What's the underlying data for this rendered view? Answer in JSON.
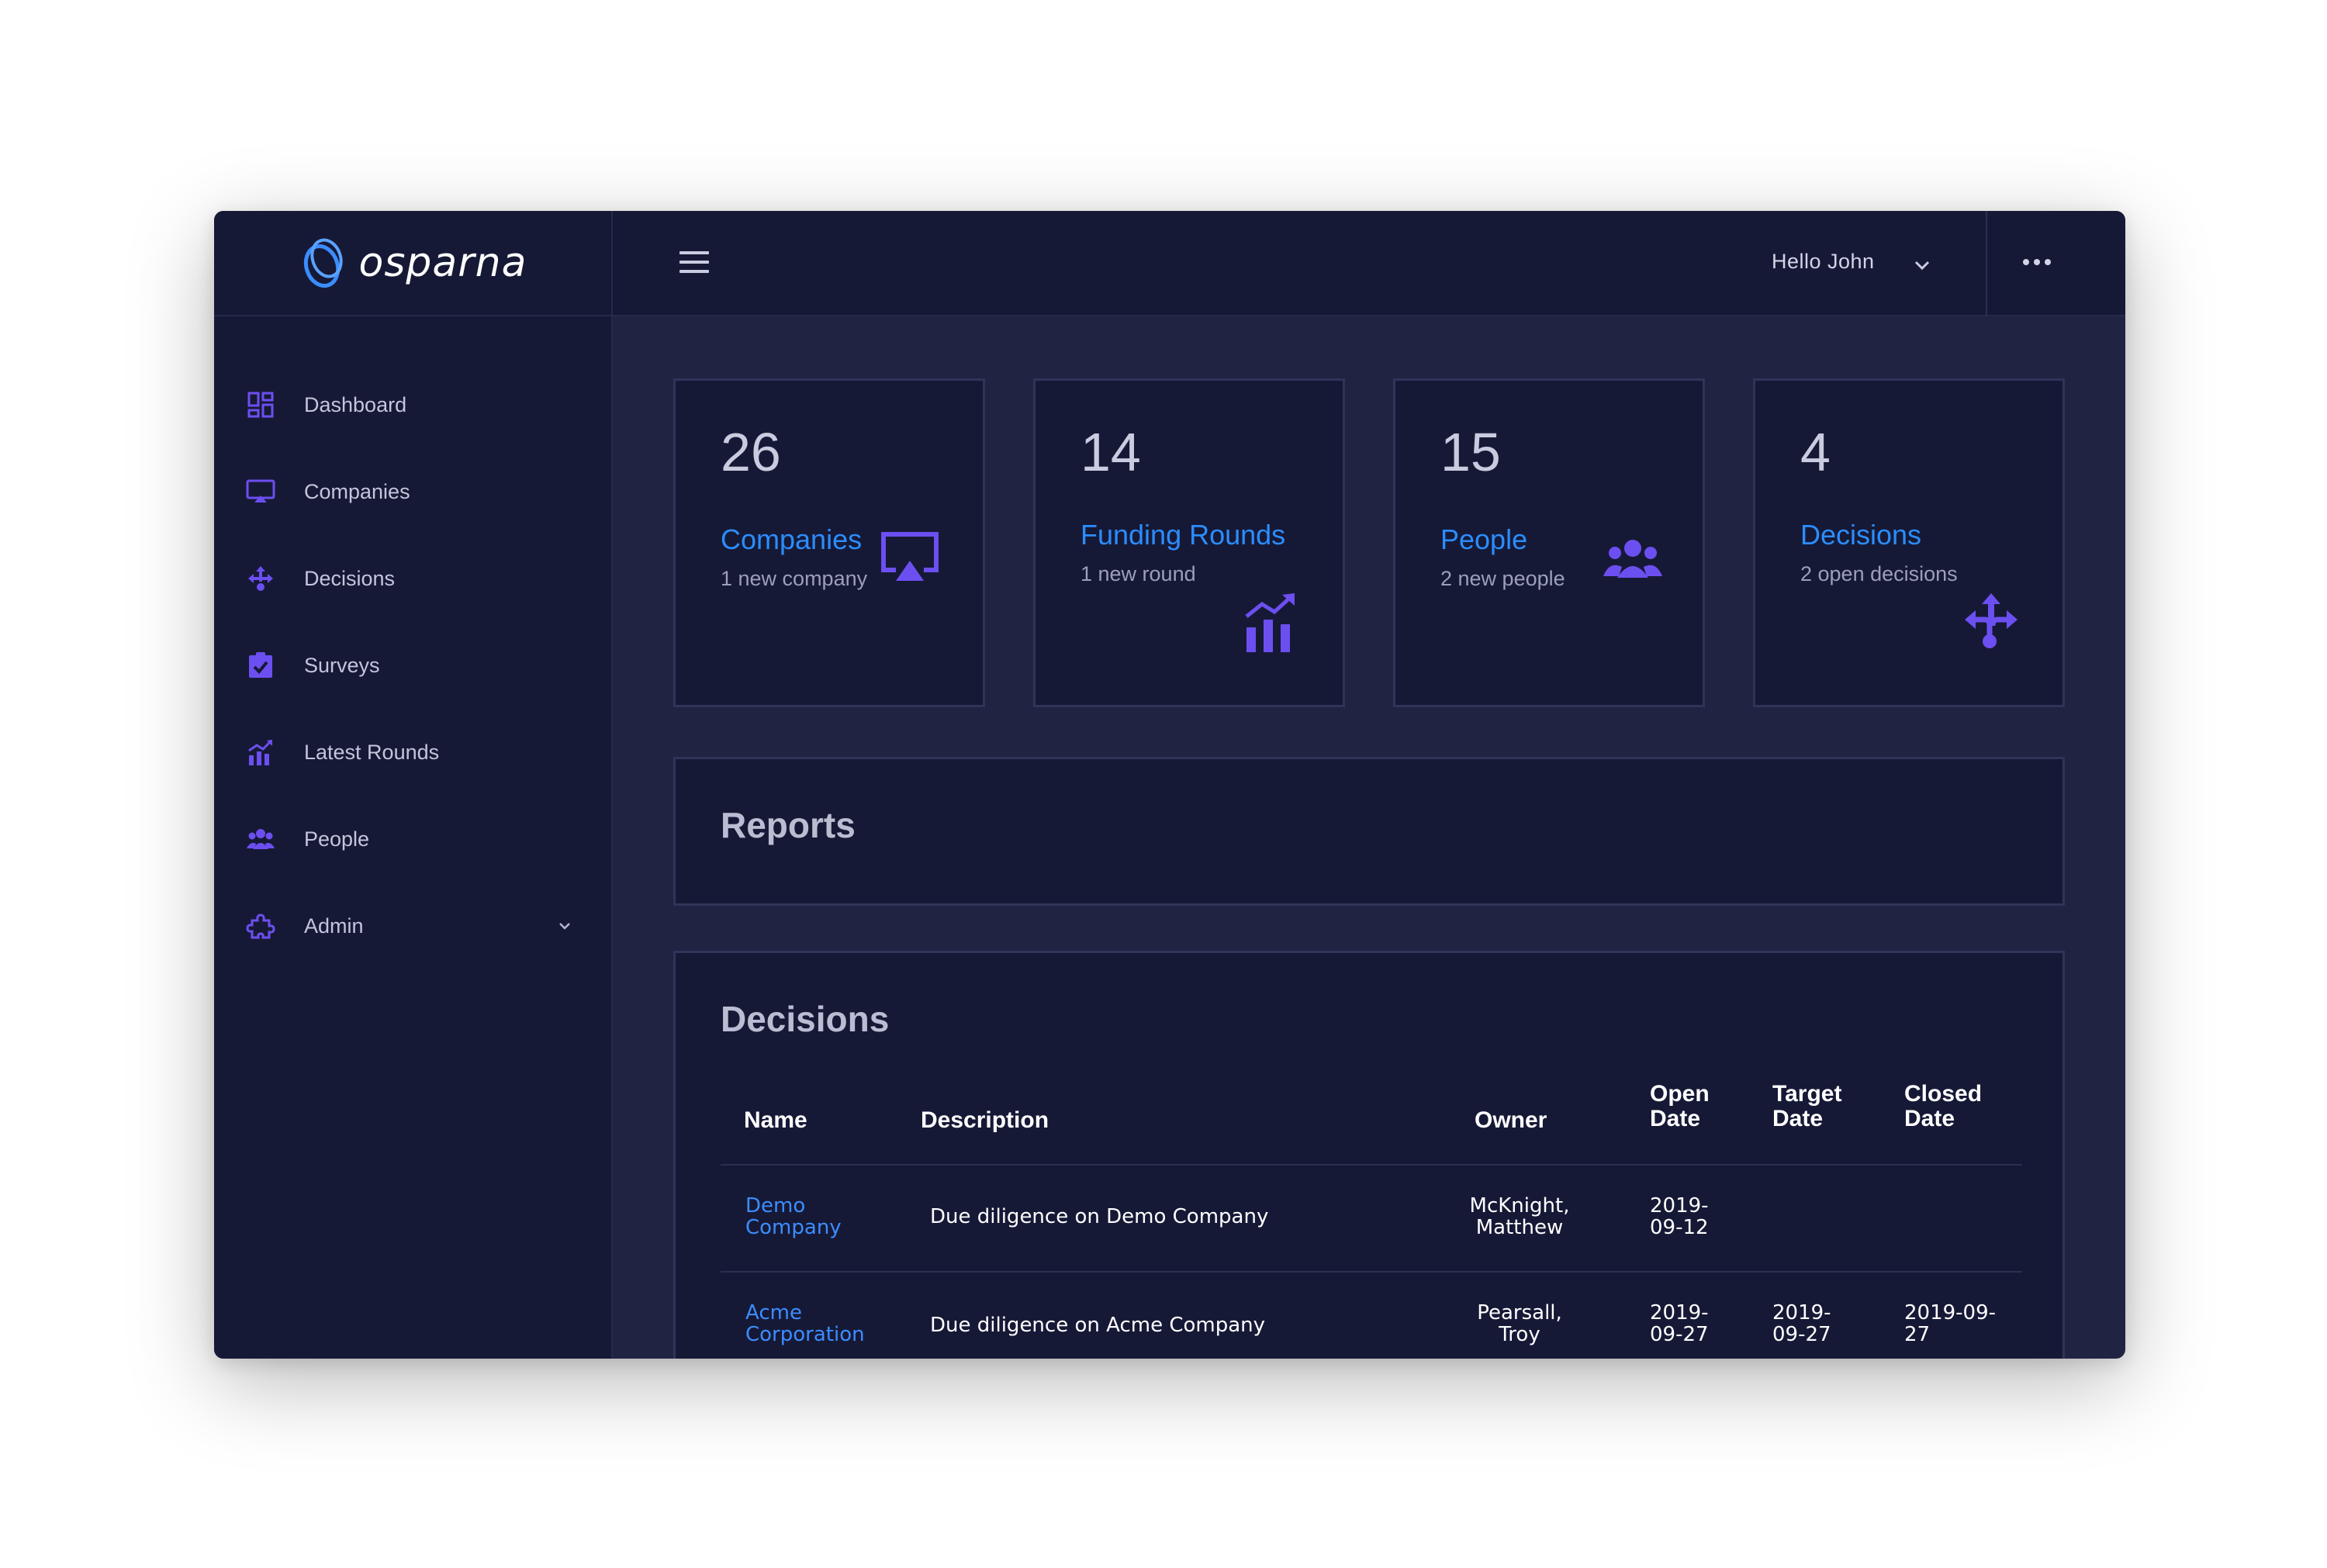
{
  "brand": {
    "name": "osparna"
  },
  "header": {
    "greeting": "Hello John"
  },
  "sidebar": {
    "items": [
      {
        "label": "Dashboard",
        "icon": "dashboard-icon"
      },
      {
        "label": "Companies",
        "icon": "monitor-icon"
      },
      {
        "label": "Decisions",
        "icon": "split-arrows-icon"
      },
      {
        "label": "Surveys",
        "icon": "clipboard-check-icon"
      },
      {
        "label": "Latest Rounds",
        "icon": "bar-chart-icon"
      },
      {
        "label": "People",
        "icon": "people-icon"
      },
      {
        "label": "Admin",
        "icon": "puzzle-icon"
      }
    ]
  },
  "cards": [
    {
      "count": "26",
      "title": "Companies",
      "subtitle": "1 new company",
      "icon": "airplay-icon"
    },
    {
      "count": "14",
      "title": "Funding Rounds",
      "subtitle": "1 new round",
      "icon": "growth-chart-icon"
    },
    {
      "count": "15",
      "title": "People",
      "subtitle": "2 new people",
      "icon": "people-group-icon"
    },
    {
      "count": "4",
      "title": "Decisions",
      "subtitle": "2 open decisions",
      "icon": "split-arrows-icon"
    }
  ],
  "reports": {
    "title": "Reports"
  },
  "decisions": {
    "title": "Decisions",
    "columns": {
      "name": "Name",
      "description": "Description",
      "owner": "Owner",
      "open_date_1": "Open",
      "open_date_2": "Date",
      "target_date_1": "Target",
      "target_date_2": "Date",
      "closed_date_1": "Closed",
      "closed_date_2": "Date"
    },
    "rows": [
      {
        "name_1": "Demo",
        "name_2": "Company",
        "description": "Due diligence on Demo Company",
        "owner_1": "McKnight,",
        "owner_2": "Matthew",
        "open_1": "2019-",
        "open_2": "09-12",
        "target_1": "",
        "target_2": "",
        "closed_1": "",
        "closed_2": ""
      },
      {
        "name_1": "Acme",
        "name_2": "Corporation",
        "description": "Due diligence on Acme Company",
        "owner_1": "Pearsall,",
        "owner_2": "Troy",
        "open_1": "2019-",
        "open_2": "09-27",
        "target_1": "2019-",
        "target_2": "09-27",
        "closed_1": "2019-09-",
        "closed_2": "27"
      }
    ]
  },
  "colors": {
    "accent_blue": "#2b8dff",
    "icon_purple": "#6c4ff0",
    "panel_bg": "#161936",
    "content_bg": "#202442"
  }
}
